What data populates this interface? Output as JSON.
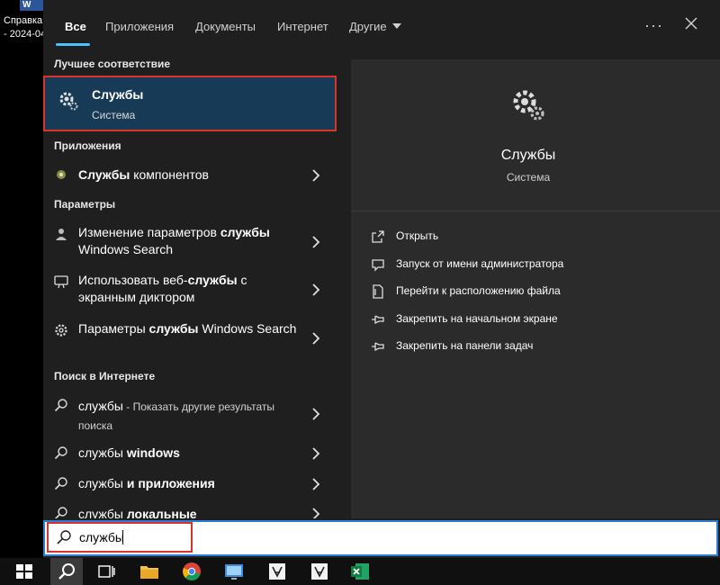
{
  "desktop": {
    "word_icon_letter": "W",
    "file_label_line1": "Справка",
    "file_label_line2": "- 2024-04"
  },
  "tabs": [
    {
      "label": "Все",
      "active": true
    },
    {
      "label": "Приложения"
    },
    {
      "label": "Документы"
    },
    {
      "label": "Интернет"
    },
    {
      "label": "Другие"
    }
  ],
  "topbar": {
    "more": "···"
  },
  "best_match": {
    "header": "Лучшее соответствие",
    "title": "Службы",
    "subtitle": "Система"
  },
  "apps": {
    "header": "Приложения",
    "items": [
      {
        "bold": "Службы",
        "rest": " компонентов"
      }
    ]
  },
  "settings": {
    "header": "Параметры",
    "items": [
      {
        "pre": "Изменение параметров ",
        "bold": "службы",
        "post": " Windows Search"
      },
      {
        "pre": "Использовать веб-",
        "bold": "службы",
        "post": " с экранным диктором"
      },
      {
        "pre": "Параметры ",
        "bold": "службы",
        "post": " Windows Search"
      }
    ]
  },
  "web": {
    "header": "Поиск в Интернете",
    "items": [
      {
        "main": "службы",
        "sub": " - Показать другие результаты поиска"
      },
      {
        "main": "службы",
        "bold": " windows"
      },
      {
        "main": "службы",
        "bold": " и приложения"
      },
      {
        "main": "службы",
        "bold": " локальные"
      }
    ]
  },
  "preview": {
    "title": "Службы",
    "subtitle": "Система",
    "actions": [
      {
        "icon": "open-icon",
        "label": "Открыть"
      },
      {
        "icon": "run-as-admin-icon",
        "label": "Запуск от имени администратора"
      },
      {
        "icon": "file-location-icon",
        "label": "Перейти к расположению файла"
      },
      {
        "icon": "pin-icon",
        "label": "Закрепить на начальном экране"
      },
      {
        "icon": "pin-icon",
        "label": "Закрепить на панели задач"
      }
    ]
  },
  "search": {
    "value": "службы"
  },
  "colors": {
    "accent": "#4cc2ff",
    "best_match_bg": "#173a56",
    "highlight_border": "#d9342b",
    "panel_bg": "#1f1f1f",
    "preview_bg": "#2b2b2b"
  }
}
